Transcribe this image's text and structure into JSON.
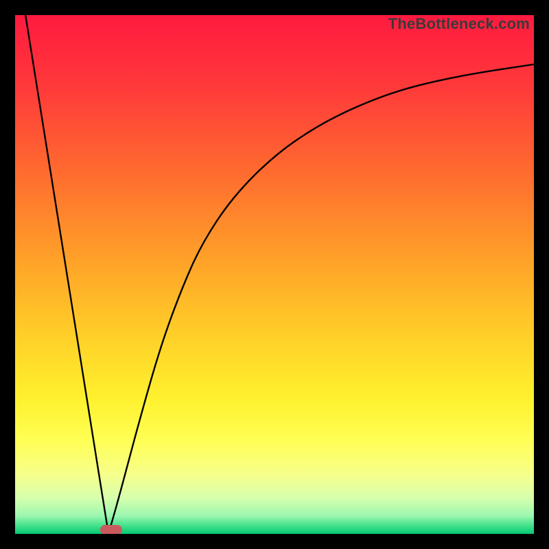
{
  "watermark": "TheBottleneck.com",
  "colors": {
    "frame": "#000000",
    "curve": "#000000",
    "marker": "#ca5a5f",
    "gradient_stops": [
      {
        "offset": 0.0,
        "color": "#ff1a3f"
      },
      {
        "offset": 0.14,
        "color": "#ff3a3a"
      },
      {
        "offset": 0.3,
        "color": "#ff6a2f"
      },
      {
        "offset": 0.48,
        "color": "#ffa428"
      },
      {
        "offset": 0.62,
        "color": "#ffd028"
      },
      {
        "offset": 0.74,
        "color": "#fff12e"
      },
      {
        "offset": 0.82,
        "color": "#ffff55"
      },
      {
        "offset": 0.885,
        "color": "#f6ff8a"
      },
      {
        "offset": 0.93,
        "color": "#d8ffad"
      },
      {
        "offset": 0.965,
        "color": "#9cf7b0"
      },
      {
        "offset": 0.985,
        "color": "#3fe08a"
      },
      {
        "offset": 1.0,
        "color": "#06c874"
      }
    ]
  },
  "chart_data": {
    "type": "line",
    "title": "",
    "xlabel": "",
    "ylabel": "",
    "xlim": [
      0,
      100
    ],
    "ylim": [
      0,
      100
    ],
    "x_min_at": 18,
    "y_min": 0,
    "left_leg": {
      "x_start": 2,
      "y_start": 100,
      "x_end": 18,
      "y_end": 0
    },
    "right_curve": [
      {
        "x": 18,
        "y": 0.0
      },
      {
        "x": 20,
        "y": 7.0
      },
      {
        "x": 24,
        "y": 22.0
      },
      {
        "x": 28,
        "y": 36.0
      },
      {
        "x": 32,
        "y": 47.0
      },
      {
        "x": 36,
        "y": 56.0
      },
      {
        "x": 42,
        "y": 65.0
      },
      {
        "x": 50,
        "y": 73.0
      },
      {
        "x": 58,
        "y": 78.5
      },
      {
        "x": 66,
        "y": 82.5
      },
      {
        "x": 74,
        "y": 85.5
      },
      {
        "x": 82,
        "y": 87.5
      },
      {
        "x": 90,
        "y": 89.0
      },
      {
        "x": 100,
        "y": 90.5
      }
    ],
    "marker": {
      "x": 18.5,
      "y": 0.8
    }
  }
}
